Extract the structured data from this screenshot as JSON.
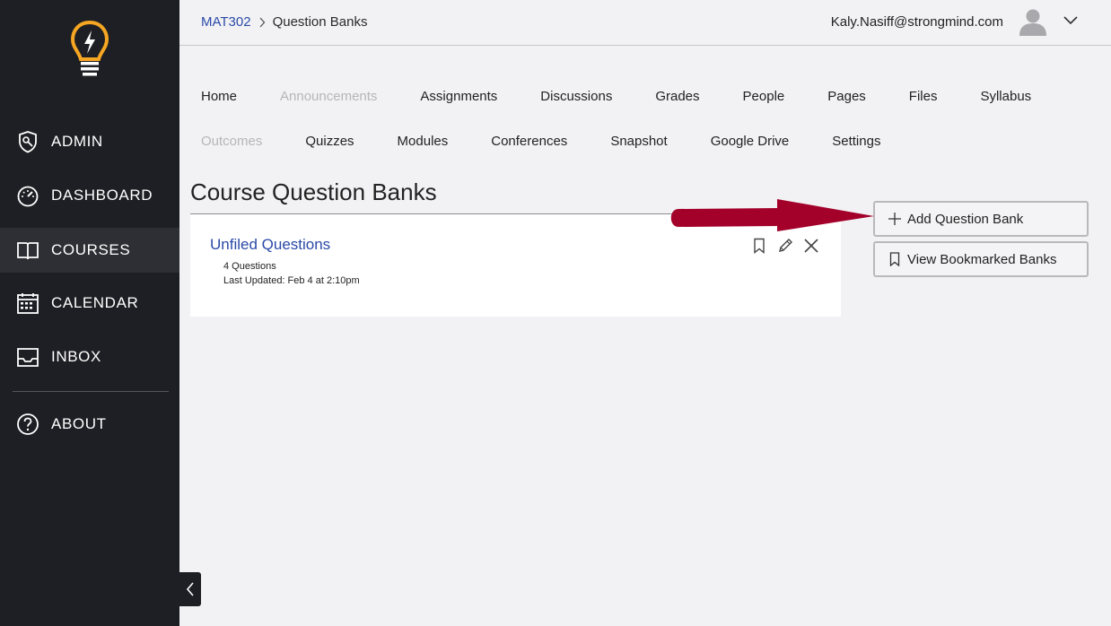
{
  "sidebar": {
    "items": [
      {
        "label": "ADMIN",
        "icon": "shield-icon"
      },
      {
        "label": "DASHBOARD",
        "icon": "speedometer-icon"
      },
      {
        "label": "COURSES",
        "icon": "book-icon"
      },
      {
        "label": "CALENDAR",
        "icon": "calendar-icon"
      },
      {
        "label": "INBOX",
        "icon": "inbox-icon"
      },
      {
        "label": "ABOUT",
        "icon": "help-icon"
      }
    ],
    "active": "COURSES",
    "colors": {
      "background": "#1e1f24",
      "active": "#2e2f34",
      "logo": "#f5a623"
    }
  },
  "header": {
    "breadcrumb": {
      "course": "MAT302",
      "current": "Question Banks"
    },
    "user_email": "Kaly.Nasiff@strongmind.com"
  },
  "course_nav": {
    "row1": [
      {
        "label": "Home",
        "disabled": false
      },
      {
        "label": "Announcements",
        "disabled": true
      },
      {
        "label": "Assignments",
        "disabled": false
      },
      {
        "label": "Discussions",
        "disabled": false
      },
      {
        "label": "Grades",
        "disabled": false
      },
      {
        "label": "People",
        "disabled": false
      },
      {
        "label": "Pages",
        "disabled": false
      },
      {
        "label": "Files",
        "disabled": false
      },
      {
        "label": "Syllabus",
        "disabled": false
      }
    ],
    "row2": [
      {
        "label": "Outcomes",
        "disabled": true
      },
      {
        "label": "Quizzes",
        "disabled": false
      },
      {
        "label": "Modules",
        "disabled": false
      },
      {
        "label": "Conferences",
        "disabled": false
      },
      {
        "label": "Snapshot",
        "disabled": false
      },
      {
        "label": "Google Drive",
        "disabled": false
      },
      {
        "label": "Settings",
        "disabled": false
      }
    ]
  },
  "main": {
    "title": "Course Question Banks",
    "banks": [
      {
        "title": "Unfiled Questions",
        "count": "4 Questions",
        "updated": "Last Updated: Feb 4 at 2:10pm"
      }
    ],
    "buttons": {
      "add": "Add Question Bank",
      "bookmarked": "View Bookmarked Banks"
    }
  },
  "annotation": {
    "arrow_color": "#a3002a"
  }
}
